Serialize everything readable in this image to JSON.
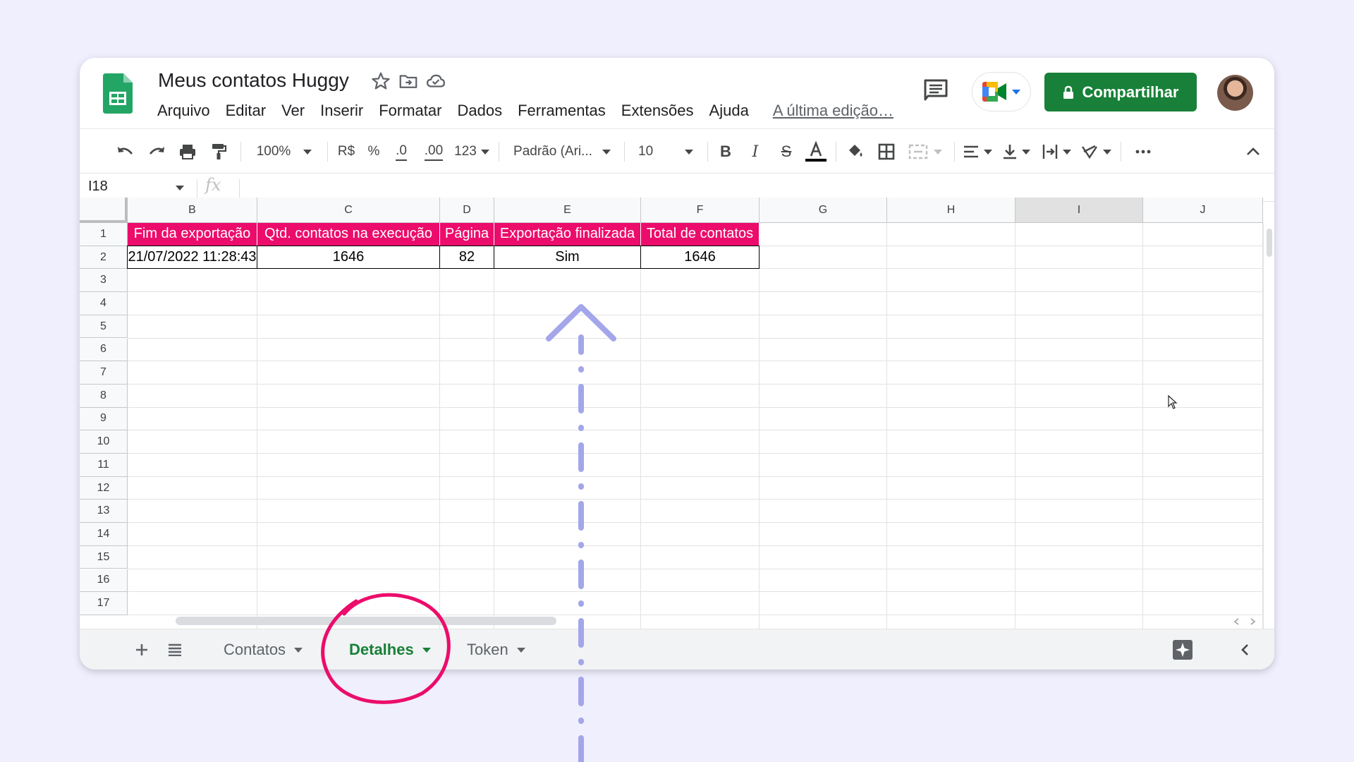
{
  "header": {
    "title": "Meus contatos Huggy",
    "menu": [
      "Arquivo",
      "Editar",
      "Ver",
      "Inserir",
      "Formatar",
      "Dados",
      "Ferramentas",
      "Extensões",
      "Ajuda"
    ],
    "last_edit": "A última edição…",
    "share_label": "Compartilhar"
  },
  "toolbar": {
    "zoom": "100%",
    "currency": "R$",
    "percent": "%",
    "decrease_decimals": ".0",
    "increase_decimals": ".00",
    "more_formats": "123",
    "font": "Padrão (Ari...",
    "font_size": "10"
  },
  "formula_bar": {
    "name_box": "I18",
    "fx": "fx"
  },
  "grid": {
    "columns": [
      "B",
      "C",
      "D",
      "E",
      "F",
      "G",
      "H",
      "I",
      "J"
    ],
    "selected_column": "I",
    "rows": [
      "1",
      "2",
      "3",
      "4",
      "5",
      "6",
      "7",
      "8",
      "9",
      "10",
      "11",
      "12",
      "13",
      "14",
      "15",
      "16",
      "17"
    ],
    "header_row": [
      "Fim da exportação",
      "Qtd. contatos na execução",
      "Página",
      "Exportação finalizada",
      "Total de contatos"
    ],
    "data_row": [
      "21/07/2022 11:28:43",
      "1646",
      "82",
      "Sim",
      "1646"
    ]
  },
  "sheets": {
    "tabs": [
      "Contatos",
      "Detalhes",
      "Token"
    ],
    "active": "Detalhes"
  },
  "colors": {
    "header_fill": "#ec0c6b",
    "share_button": "#188038",
    "annotation_circle": "#ec0c6b",
    "annotation_arrow": "#a4a6ea"
  }
}
